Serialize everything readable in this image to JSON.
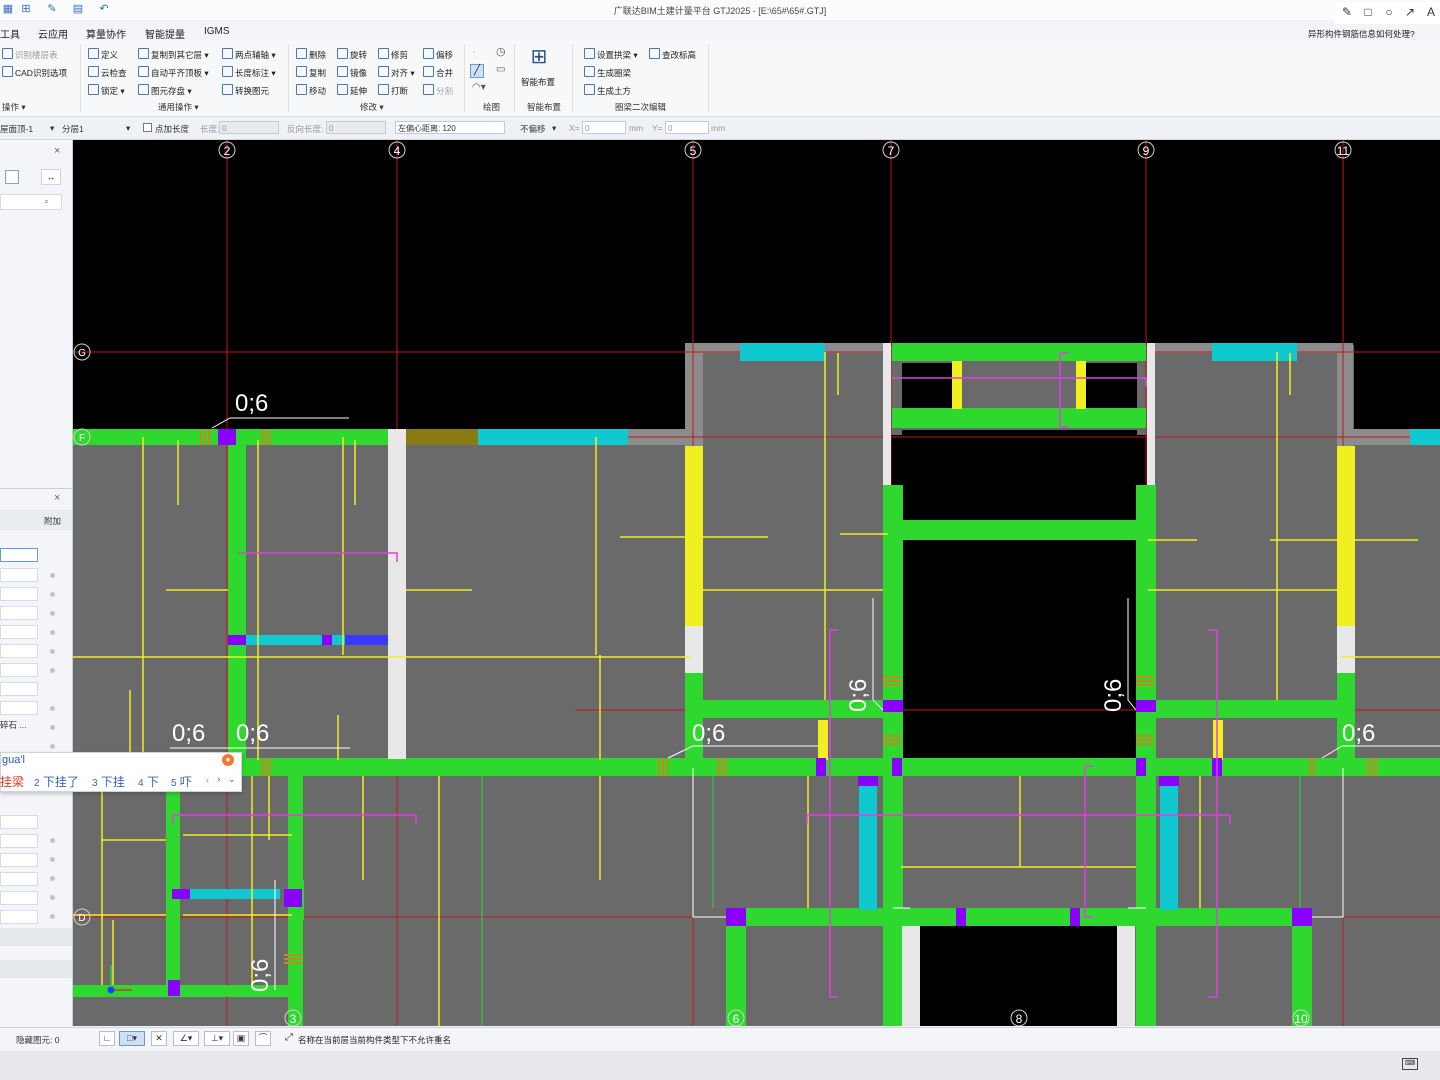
{
  "window": {
    "title": "广联达BIM土建计量平台 GTJ2025 - [E:\\65#\\65#.GTJ]"
  },
  "menu": [
    "工具",
    "云应用",
    "算量协作",
    "智能提量",
    "IGMS"
  ],
  "hint_text": "异形构件钢筋信息如何处理?",
  "annot_tools": [
    "✎",
    "□",
    "○",
    "↗",
    "A"
  ],
  "ribbon": {
    "col1": [
      "识别楼层表",
      "CAD识别选项"
    ],
    "col1_group": "操作 ▾",
    "col2": [
      "定义",
      "云检查",
      "锁定 ▾"
    ],
    "col3": [
      "复制到其它层 ▾",
      "自动平齐顶板 ▾",
      "图元存盘 ▾"
    ],
    "col4": [
      "两点辅轴 ▾",
      "长度标注 ▾",
      "转换图元"
    ],
    "group_common": "通用操作 ▾",
    "col5": [
      "删除",
      "复制",
      "移动"
    ],
    "col6": [
      "旋转",
      "镜像",
      "延伸"
    ],
    "col7": [
      "修剪",
      "对齐 ▾",
      "打断"
    ],
    "col8": [
      "偏移",
      "合并",
      "分割"
    ],
    "group_modify": "修改 ▾",
    "group_draw": "绘图",
    "smart_layout": "智能布置",
    "group_smart": "智能布置",
    "col9": [
      "设置拱梁 ▾",
      "生成圈梁",
      "生成土方"
    ],
    "col10": [
      "查改标高"
    ],
    "group_secondary": "圈梁二次编辑"
  },
  "propbar": {
    "layer": "屋面顶-1",
    "sublayer": "分层1",
    "checkbox_label": "点加长度",
    "length_label": "长度:",
    "length_value": "0",
    "reverse_label": "反向长度:",
    "reverse_value": "0",
    "offset_label": "左偏心距离: 120",
    "shift_mode": "不偏移",
    "x_label": "X=",
    "x_value": "0",
    "y_label": "Y=",
    "y_value": "0",
    "unit": "mm"
  },
  "left_panel": {
    "tab_label": "附加",
    "row_text": "碎石 ..."
  },
  "axes_top": [
    "2",
    "4",
    "5",
    "7",
    "9",
    "11"
  ],
  "axes_bottom": [
    "3",
    "6",
    "8",
    "10"
  ],
  "axes_left": [
    "G",
    "F",
    "D"
  ],
  "drawing_labels": [
    "0;6",
    "0;6",
    "0;6",
    "0;6",
    "0;6",
    "0;6",
    "0;6",
    "0;6",
    "0;6"
  ],
  "ime": {
    "input": "gua'l",
    "candidates": [
      {
        "num": "",
        "text": "挂梁"
      },
      {
        "num": "2",
        "text": "下挂了"
      },
      {
        "num": "3",
        "text": "下挂"
      },
      {
        "num": "4",
        "text": "下"
      },
      {
        "num": "5",
        "text": "吓"
      }
    ]
  },
  "status": {
    "hidden_label": "隐藏图元: 0",
    "message": "名称在当前层当前构件类型下不允许重名"
  },
  "colors": {
    "wall_green": "#2ed82e",
    "beam_yellow": "#f0f020",
    "cyan": "#10c8d0",
    "purple": "#8a00ff",
    "magenta": "#e040e0",
    "grid_red": "#c01818",
    "fill_gray": "#6a6a6a"
  }
}
